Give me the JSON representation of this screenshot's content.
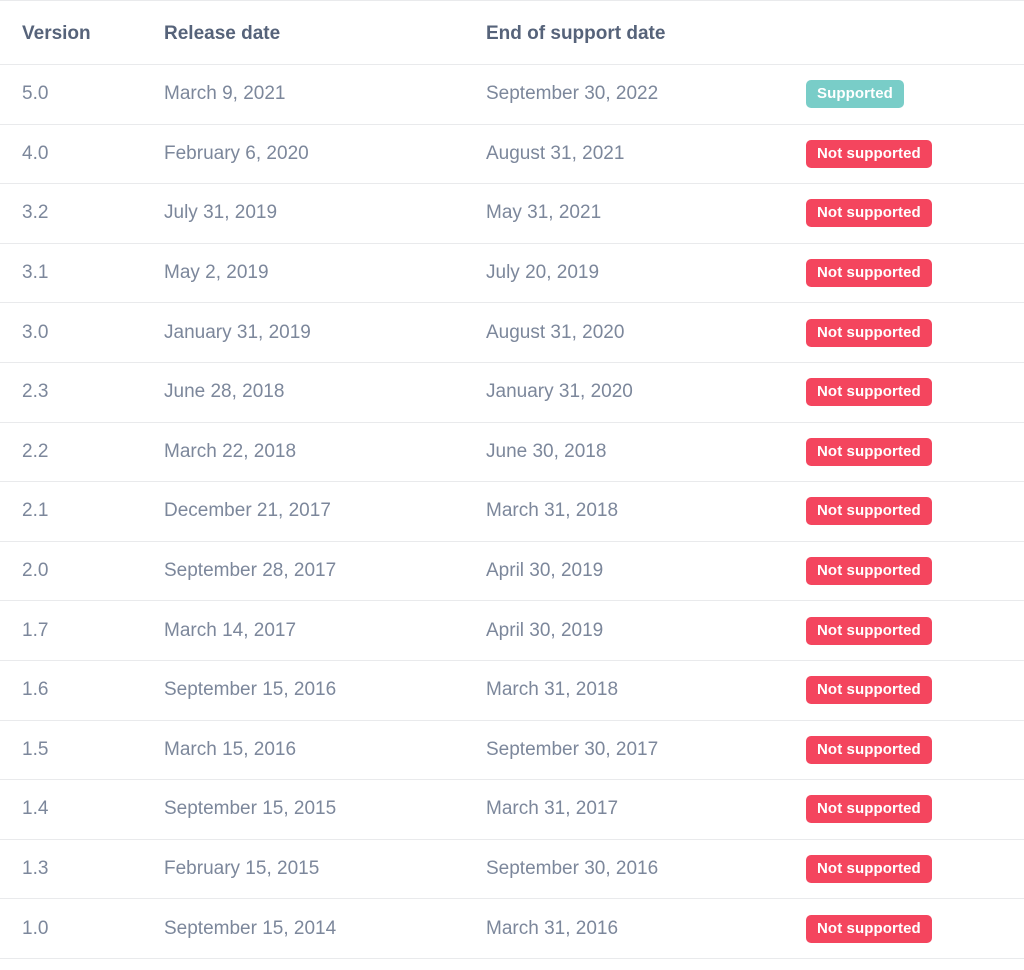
{
  "table": {
    "columns": [
      {
        "key": "version",
        "label": "Version"
      },
      {
        "key": "release_date",
        "label": "Release date"
      },
      {
        "key": "end_of_support_date",
        "label": "End of support date"
      },
      {
        "key": "status",
        "label": ""
      }
    ],
    "status_labels": {
      "supported": "Supported",
      "not_supported": "Not supported"
    },
    "status_colors": {
      "supported": "#79cdc8",
      "not_supported": "#f4455e"
    },
    "text_colors": {
      "header": "#56637a",
      "body": "#7c879b",
      "divider": "#e9eaec",
      "background": "#ffffff"
    },
    "rows": [
      {
        "version": "5.0",
        "release_date": "March 9, 2021",
        "end_of_support_date": "September 30, 2022",
        "status": "Supported"
      },
      {
        "version": "4.0",
        "release_date": "February 6, 2020",
        "end_of_support_date": "August 31, 2021",
        "status": "Not supported"
      },
      {
        "version": "3.2",
        "release_date": "July 31, 2019",
        "end_of_support_date": "May 31, 2021",
        "status": "Not supported"
      },
      {
        "version": "3.1",
        "release_date": "May 2, 2019",
        "end_of_support_date": "July 20, 2019",
        "status": "Not supported"
      },
      {
        "version": "3.0",
        "release_date": "January 31, 2019",
        "end_of_support_date": "August 31, 2020",
        "status": "Not supported"
      },
      {
        "version": "2.3",
        "release_date": "June 28, 2018",
        "end_of_support_date": "January 31, 2020",
        "status": "Not supported"
      },
      {
        "version": "2.2",
        "release_date": "March 22, 2018",
        "end_of_support_date": "June 30, 2018",
        "status": "Not supported"
      },
      {
        "version": "2.1",
        "release_date": "December 21, 2017",
        "end_of_support_date": "March 31, 2018",
        "status": "Not supported"
      },
      {
        "version": "2.0",
        "release_date": "September 28, 2017",
        "end_of_support_date": "April 30, 2019",
        "status": "Not supported"
      },
      {
        "version": "1.7",
        "release_date": "March 14, 2017",
        "end_of_support_date": "April 30, 2019",
        "status": "Not supported"
      },
      {
        "version": "1.6",
        "release_date": "September 15, 2016",
        "end_of_support_date": "March 31, 2018",
        "status": "Not supported"
      },
      {
        "version": "1.5",
        "release_date": "March 15, 2016",
        "end_of_support_date": "September 30, 2017",
        "status": "Not supported"
      },
      {
        "version": "1.4",
        "release_date": "September 15, 2015",
        "end_of_support_date": "March 31, 2017",
        "status": "Not supported"
      },
      {
        "version": "1.3",
        "release_date": "February 15, 2015",
        "end_of_support_date": "September 30, 2016",
        "status": "Not supported"
      },
      {
        "version": "1.0",
        "release_date": "September 15, 2014",
        "end_of_support_date": "March 31, 2016",
        "status": "Not supported"
      }
    ]
  }
}
